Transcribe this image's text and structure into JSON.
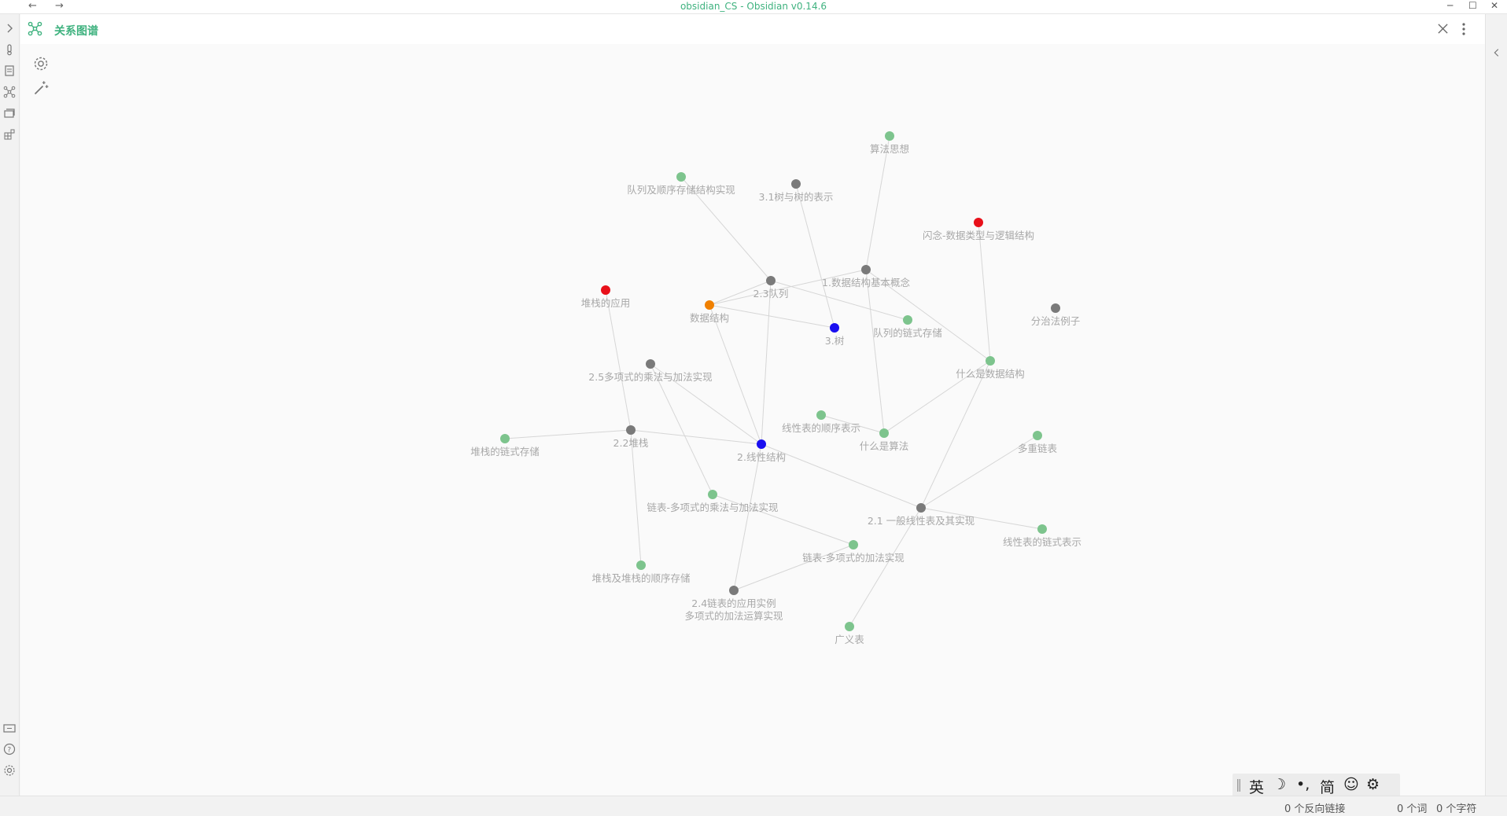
{
  "window": {
    "title": "obsidian_CS - Obsidian v0.14.6",
    "back_arrow": "←",
    "forward_arrow": "→",
    "minimize": "─",
    "maximize": "☐",
    "close": "✕"
  },
  "view": {
    "title": "关系图谱"
  },
  "colors": {
    "accent": "#3fb27f",
    "node_green": "#7dc48d",
    "node_gray": "#7a7a7a",
    "node_red": "#e8101a",
    "node_blue": "#1a0ff0",
    "node_orange": "#f08000",
    "edge": "#d6d6d6"
  },
  "graph": {
    "nodes": [
      {
        "id": "n1",
        "label": "算法思想",
        "color": "green"
      },
      {
        "id": "n2",
        "label": "队列及顺序存储结构实现",
        "color": "green"
      },
      {
        "id": "n3",
        "label": "3.1树与树的表示",
        "color": "gray"
      },
      {
        "id": "n4",
        "label": "闪念-数据类型与逻辑结构",
        "color": "red"
      },
      {
        "id": "n5",
        "label": "2.3队列",
        "color": "gray"
      },
      {
        "id": "n6",
        "label": "1.数据结构基本概念",
        "color": "gray"
      },
      {
        "id": "n7",
        "label": "堆栈的应用",
        "color": "red"
      },
      {
        "id": "n8",
        "label": "数据结构",
        "color": "orange"
      },
      {
        "id": "n9",
        "label": "3.树",
        "color": "blue"
      },
      {
        "id": "n10",
        "label": "队列的链式存储",
        "color": "green"
      },
      {
        "id": "n11",
        "label": "分治法例子",
        "color": "gray"
      },
      {
        "id": "n12",
        "label": "2.5多项式的乘法与加法实现",
        "color": "gray"
      },
      {
        "id": "n13",
        "label": "什么是数据结构",
        "color": "green"
      },
      {
        "id": "n14",
        "label": "线性表的顺序表示",
        "color": "green"
      },
      {
        "id": "n15",
        "label": "2.2堆栈",
        "color": "gray"
      },
      {
        "id": "n16",
        "label": "什么是算法",
        "color": "green"
      },
      {
        "id": "n17",
        "label": "堆栈的链式存储",
        "color": "green"
      },
      {
        "id": "n18",
        "label": "2.线性结构",
        "color": "blue"
      },
      {
        "id": "n19",
        "label": "多重链表",
        "color": "green"
      },
      {
        "id": "n20",
        "label": "链表-多项式的乘法与加法实现",
        "color": "green"
      },
      {
        "id": "n21",
        "label": "2.1 一般线性表及其实现",
        "color": "gray"
      },
      {
        "id": "n22",
        "label": "线性表的链式表示",
        "color": "green"
      },
      {
        "id": "n23",
        "label": "链表-多项式的加法实现",
        "color": "green"
      },
      {
        "id": "n24",
        "label": "堆栈及堆栈的顺序存储",
        "color": "green"
      },
      {
        "id": "n25",
        "label": "2.4链表的应用实例",
        "label2": "多项式的加法运算实现",
        "color": "gray"
      },
      {
        "id": "n26",
        "label": "广义表",
        "color": "green"
      }
    ],
    "edges": [
      [
        "n1",
        "n6"
      ],
      [
        "n2",
        "n5"
      ],
      [
        "n3",
        "n9"
      ],
      [
        "n4",
        "n13"
      ],
      [
        "n5",
        "n8"
      ],
      [
        "n5",
        "n10"
      ],
      [
        "n5",
        "n18"
      ],
      [
        "n6",
        "n8"
      ],
      [
        "n6",
        "n13"
      ],
      [
        "n6",
        "n16"
      ],
      [
        "n8",
        "n9"
      ],
      [
        "n8",
        "n18"
      ],
      [
        "n7",
        "n15"
      ],
      [
        "n12",
        "n18"
      ],
      [
        "n12",
        "n20"
      ],
      [
        "n15",
        "n17"
      ],
      [
        "n15",
        "n24"
      ],
      [
        "n15",
        "n18"
      ],
      [
        "n18",
        "n21"
      ],
      [
        "n18",
        "n25"
      ],
      [
        "n13",
        "n16"
      ],
      [
        "n13",
        "n21"
      ],
      [
        "n14",
        "n16"
      ],
      [
        "n21",
        "n19"
      ],
      [
        "n21",
        "n22"
      ],
      [
        "n21",
        "n26"
      ],
      [
        "n20",
        "n23"
      ],
      [
        "n23",
        "n25"
      ]
    ]
  },
  "ime_toolbar": {
    "items": [
      "英",
      "☽",
      "•,",
      "简",
      "☺",
      "⚙"
    ]
  },
  "status": {
    "backlinks": "0 个反向链接",
    "words": "0 个词",
    "chars": "0 个字符"
  }
}
